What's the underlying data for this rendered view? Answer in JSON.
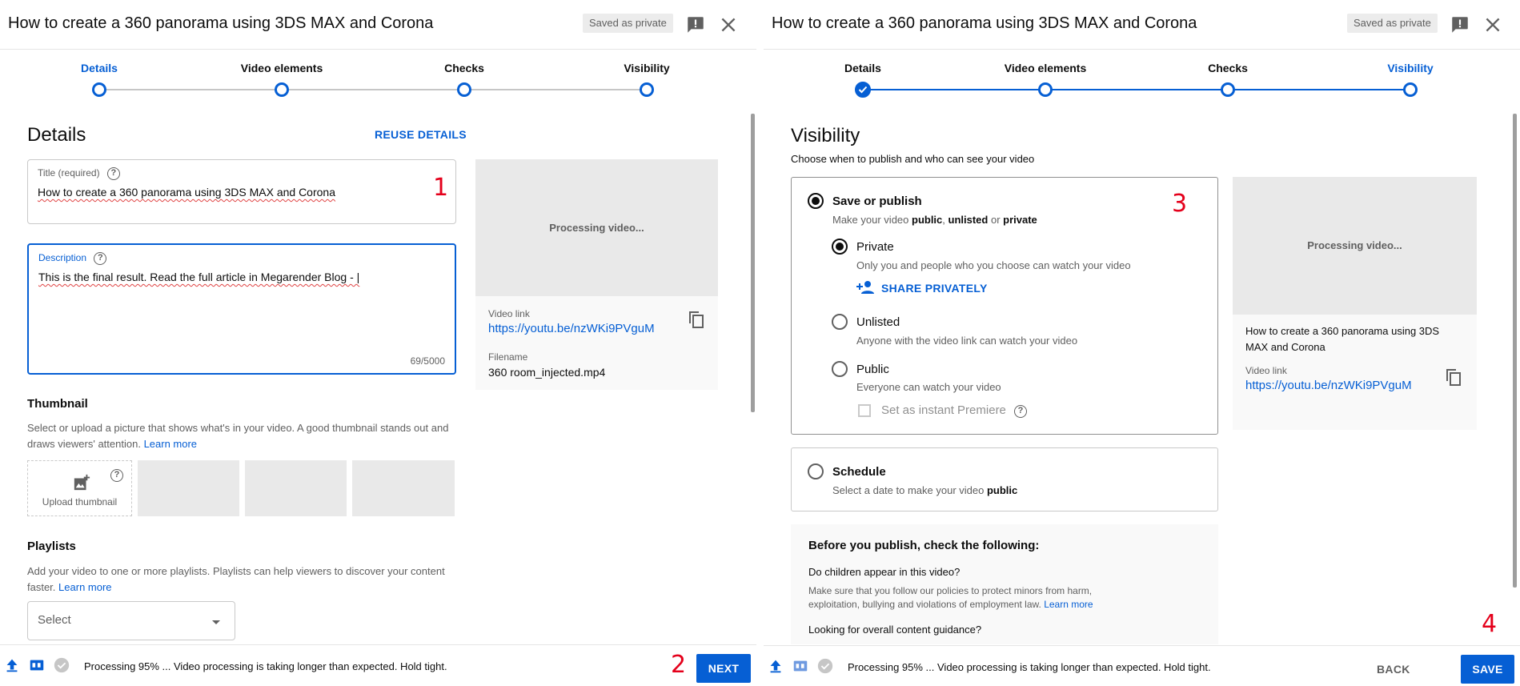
{
  "left": {
    "header": {
      "title": "How to create a 360 panorama using 3DS MAX and Corona",
      "badge": "Saved as private"
    },
    "steps": [
      "Details",
      "Video elements",
      "Checks",
      "Visibility"
    ],
    "details": {
      "heading": "Details",
      "reuse": "REUSE DETAILS",
      "title_label": "Title (required)",
      "title_value": "How to create a 360 panorama using 3DS MAX and Corona",
      "desc_label": "Description",
      "desc_value": "This is the final result. Read the full article in Megarender Blog - |",
      "desc_counter": "69/5000",
      "thumb_title": "Thumbnail",
      "thumb_text": "Select or upload a picture that shows what's in your video. A good thumbnail stands out and draws viewers' attention.",
      "thumb_link": "Learn more",
      "upload_label": "Upload thumbnail",
      "playlist_title": "Playlists",
      "playlist_text": "Add your video to one or more playlists. Playlists can help viewers to discover your content faster.",
      "playlist_link": "Learn more",
      "select_label": "Select"
    },
    "preview": {
      "processing": "Processing video...",
      "link_label": "Video link",
      "link": "https://youtu.be/nzWKi9PVguM",
      "filename_label": "Filename",
      "filename": "360 room_injected.mp4"
    },
    "footer": {
      "status": "Processing 95% ... Video processing is taking longer than expected. Hold tight.",
      "next": "NEXT"
    },
    "markers": {
      "m1": "1",
      "m2": "2"
    }
  },
  "right": {
    "header": {
      "title": "How to create a 360 panorama using 3DS MAX and Corona",
      "badge": "Saved as private"
    },
    "steps": [
      "Details",
      "Video elements",
      "Checks",
      "Visibility"
    ],
    "visibility": {
      "heading": "Visibility",
      "subtitle": "Choose when to publish and who can see your video",
      "save_title": "Save or publish",
      "save_sub_1": "Make your video ",
      "save_sub_public": "public",
      "save_sub_2": ", ",
      "save_sub_unlisted": "unlisted",
      "save_sub_3": " or ",
      "save_sub_private": "private",
      "private_title": "Private",
      "private_sub": "Only you and people who you choose can watch your video",
      "share": "SHARE PRIVATELY",
      "unlisted_title": "Unlisted",
      "unlisted_sub": "Anyone with the video link can watch your video",
      "public_title": "Public",
      "public_sub": "Everyone can watch your video",
      "premiere": "Set as instant Premiere",
      "schedule_title": "Schedule",
      "schedule_sub_1": "Select a date to make your video ",
      "schedule_sub_public": "public",
      "check_heading": "Before you publish, check the following:",
      "check_q1": "Do children appear in this video?",
      "check_t1": "Make sure that you follow our policies to protect minors from harm, exploitation, bullying and violations of employment law.",
      "check_link": "Learn more",
      "check_q2": "Looking for overall content guidance?"
    },
    "preview": {
      "processing": "Processing video...",
      "title": "How to create a 360 panorama using 3DS MAX and Corona",
      "link_label": "Video link",
      "link": "https://youtu.be/nzWKi9PVguM"
    },
    "footer": {
      "status": "Processing 95% ... Video processing is taking longer than expected. Hold tight.",
      "back": "BACK",
      "save": "SAVE"
    },
    "markers": {
      "m3": "3",
      "m4": "4"
    }
  }
}
